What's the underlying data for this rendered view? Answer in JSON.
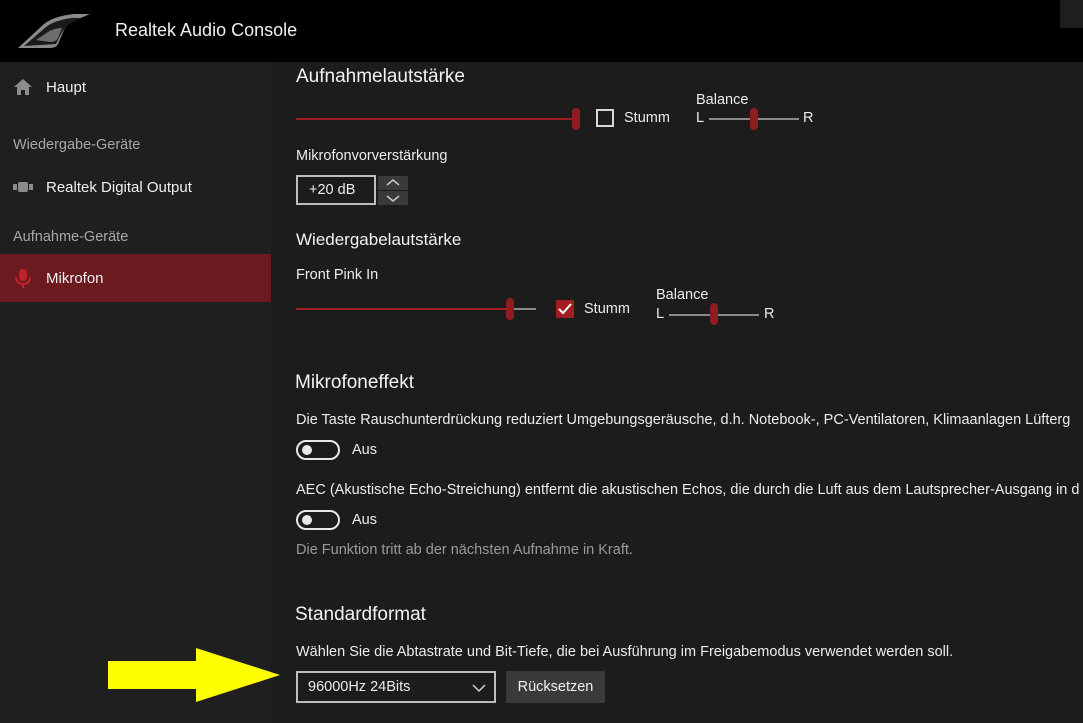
{
  "app": {
    "title": "Realtek Audio Console"
  },
  "sidebar": {
    "home_label": "Haupt",
    "playback_section": "Wiedergabe-Geräte",
    "playback_device": "Realtek Digital Output",
    "record_section": "Aufnahme-Geräte",
    "record_device": "Mikrofon"
  },
  "recording": {
    "title": "Aufnahmelautstärke",
    "volume_level": 1.0,
    "mute_label": "Stumm",
    "mute_checked": false,
    "balance_label": "Balance",
    "balance_left": "L",
    "balance_right": "R",
    "balance_value": 0.5,
    "boost_label": "Mikrofonvorverstärkung",
    "boost_value": "+20 dB"
  },
  "playback": {
    "title": "Wiedergabelautstärke",
    "source_label": "Front Pink In",
    "volume_level": 0.89,
    "mute_label": "Stumm",
    "mute_checked": true,
    "balance_label": "Balance",
    "balance_left": "L",
    "balance_right": "R",
    "balance_value": 0.5
  },
  "effects": {
    "title": "Mikrofoneffekt",
    "noise_desc": "Die Taste Rauschunterdrückung reduziert Umgebungsgeräusche, d.h. Notebook-, PC-Ventilatoren, Klimaanlagen Lüfterg",
    "noise_toggle_label": "Aus",
    "aec_desc": "AEC (Akustische Echo-Streichung) entfernt die akustischen Echos, die durch die Luft aus dem Lautsprecher-Ausgang in d",
    "aec_toggle_label": "Aus",
    "note": "Die Funktion tritt ab der nächsten Aufnahme in Kraft."
  },
  "format": {
    "title": "Standardformat",
    "desc": "Wählen Sie die Abtastrate und Bit-Tiefe, die bei Ausführung im Freigabemodus verwendet werden soll.",
    "selected": "96000Hz 24Bits",
    "reset_label": "Rücksetzen"
  },
  "colors": {
    "accent": "#a11d22",
    "active_bg": "#6b1a20",
    "arrow": "#ffff00"
  }
}
